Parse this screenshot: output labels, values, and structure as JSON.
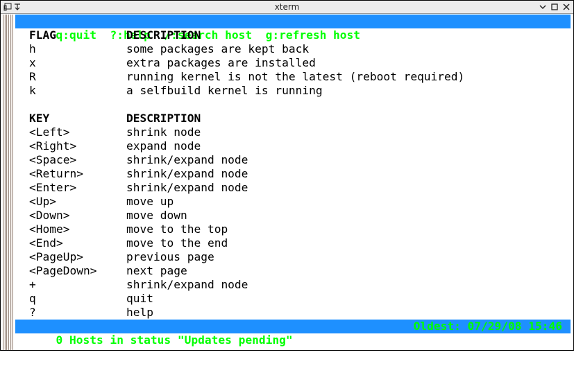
{
  "window": {
    "title": "xterm"
  },
  "top_bar": {
    "keys": "q:quit  ?:help  /:search host  g:refresh host"
  },
  "flags": {
    "header_left": "FLAG",
    "header_right": "DESCRIPTION",
    "rows": [
      {
        "key": "h",
        "desc": "some packages are kept back"
      },
      {
        "key": "x",
        "desc": "extra packages are installed"
      },
      {
        "key": "R",
        "desc": "running kernel is not the latest (reboot required)"
      },
      {
        "key": "k",
        "desc": "a selfbuild kernel is running"
      }
    ]
  },
  "keys": {
    "header_left": "KEY",
    "header_right": "DESCRIPTION",
    "rows": [
      {
        "key": "<Left>",
        "desc": "shrink node"
      },
      {
        "key": "<Right>",
        "desc": "expand node"
      },
      {
        "key": "<Space>",
        "desc": "shrink/expand node"
      },
      {
        "key": "<Return>",
        "desc": "shrink/expand node"
      },
      {
        "key": "<Enter>",
        "desc": "shrink/expand node"
      },
      {
        "key": "<Up>",
        "desc": "move up"
      },
      {
        "key": "<Down>",
        "desc": "move down"
      },
      {
        "key": "<Home>",
        "desc": "move to the top"
      },
      {
        "key": "<End>",
        "desc": "move to the end"
      },
      {
        "key": "<PageUp>",
        "desc": "previous page"
      },
      {
        "key": "<PageDown>",
        "desc": "next page"
      },
      {
        "key": "+",
        "desc": "shrink/expand node"
      },
      {
        "key": "q",
        "desc": "quit"
      },
      {
        "key": "?",
        "desc": "help"
      }
    ]
  },
  "status_bar": {
    "left": "0 Hosts in status \"Updates pending\"",
    "right": "Oldest: 07/29/08 15:46"
  },
  "colors": {
    "bar_background": "#1e90ff",
    "bar_text": "#00ff00",
    "terminal_background": "#ffffff",
    "terminal_text": "#000000"
  },
  "icons": {
    "window_menu": "window-menu-icon",
    "minimize": "minimize-icon",
    "maximize": "maximize-icon",
    "close": "close-icon"
  }
}
